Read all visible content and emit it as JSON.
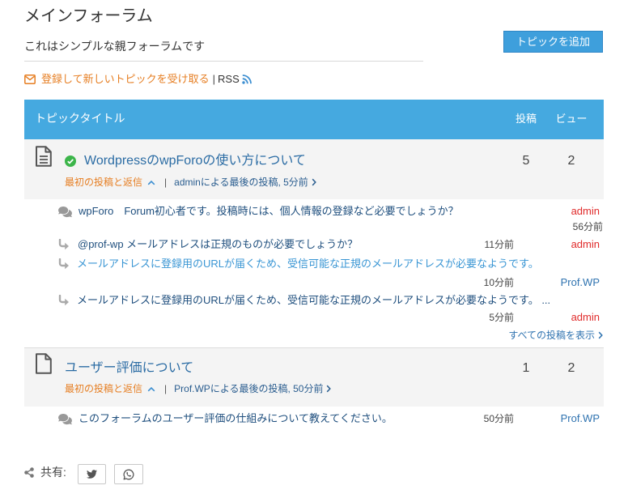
{
  "forum": {
    "title": "メインフォーラム",
    "description": "これはシンプルな親フォーラムです",
    "add_topic_label": "トピックを追加",
    "subscribe_label": "登録して新しいトピックを受け取る",
    "separator": "|",
    "rss_label": "RSS"
  },
  "table_header": {
    "title": "トピックタイトル",
    "posts": "投稿",
    "views": "ビュー"
  },
  "topics": [
    {
      "icon": "file-alt-icon",
      "solved": true,
      "title": "WordpressのwpForoの使い方について",
      "posts": "5",
      "views": "2",
      "first_post_label": "最初の投稿と返信",
      "last_post": "adminによる最後の投稿, 5分前",
      "replies": [
        {
          "icon": "comments-icon",
          "text": "wpForo　Forum初心者です。投稿時には、個人情報の登録など必要でしょうか？",
          "author": "admin",
          "time": "56分前"
        },
        {
          "icon": "reply-icon",
          "text": "@prof-wp メールアドレスは正規のものが必要でしょうか？",
          "time": "11分前",
          "author": "admin"
        },
        {
          "icon": "reply-icon",
          "text": "メールアドレスに登録用のURLが届くため、受信可能な正規のメールアドレスが必要なようです。",
          "time": "10分前",
          "author": "Prof.WP"
        },
        {
          "icon": "reply-icon",
          "text": "メールアドレスに登録用のURLが届くため、受信可能な正規のメールアドレスが必要なようです。 ...",
          "time": "5分前",
          "author": "admin"
        }
      ],
      "view_all_label": "すべての投稿を表示"
    },
    {
      "icon": "file-icon",
      "solved": false,
      "title": "ユーザー評価について",
      "posts": "1",
      "views": "2",
      "first_post_label": "最初の投稿と返信",
      "last_post": "Prof.WPによる最後の投稿, 50分前",
      "replies": [
        {
          "icon": "comments-icon",
          "text": "このフォーラムのユーザー評価の仕組みについて教えてください。",
          "time": "50分前",
          "author": "Prof.WP"
        }
      ]
    }
  ],
  "share": {
    "label": "共有:",
    "buttons": [
      {
        "icon": "twitter-icon"
      },
      {
        "icon": "whatsapp-icon"
      }
    ]
  },
  "colors": {
    "header_bg": "#45a9e0",
    "button_bg": "#3e9fdc",
    "accent_orange": "#e67e22",
    "title_blue": "#2b6ca4",
    "link_blue": "#2a5d8f",
    "reply_blue": "#1f4f7e",
    "light_blue": "#3a96d4",
    "author_red": "#e02b2b",
    "author_blue": "#2f73b0",
    "solved_green": "#3cb54a",
    "row_bg": "#f4f4f4"
  }
}
